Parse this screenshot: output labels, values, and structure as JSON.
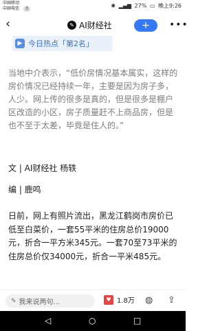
{
  "status_bar": {
    "carrier1": "中国移动",
    "carrier2": "中国电信",
    "notif_count": "3",
    "battery": "27%",
    "time": "晚上9:26"
  },
  "app_bar": {
    "back": "‹",
    "brand_name": "AI财经社",
    "follow": "+",
    "more": "•••"
  },
  "hot_banner": {
    "text": "今日热点「第2名」"
  },
  "article": {
    "quote": "当地中介表示，“低价房情况基本属实，这样的房价情况已经持续一年，主要是因为房子多，人少。网上传的很多是真的，但是很多是棚户区改造的小区，房子质量赶不上商品房，但是也不至于太差，毕竟是住人的。”",
    "byline": "文 | AI财经社 杨轶",
    "editor": "编 | 鹿鸣",
    "body": "日前，网上有照片流出，黑龙江鹤岗市房价已低至白菜价，一套55平米的住房总价19000元，折合一平方米345元。一套70至73平米的住房总价仅34000元，折合一平米485元。"
  },
  "bottom_bar": {
    "comment_placeholder": "我来说两句...",
    "like_count": "1.8万"
  }
}
